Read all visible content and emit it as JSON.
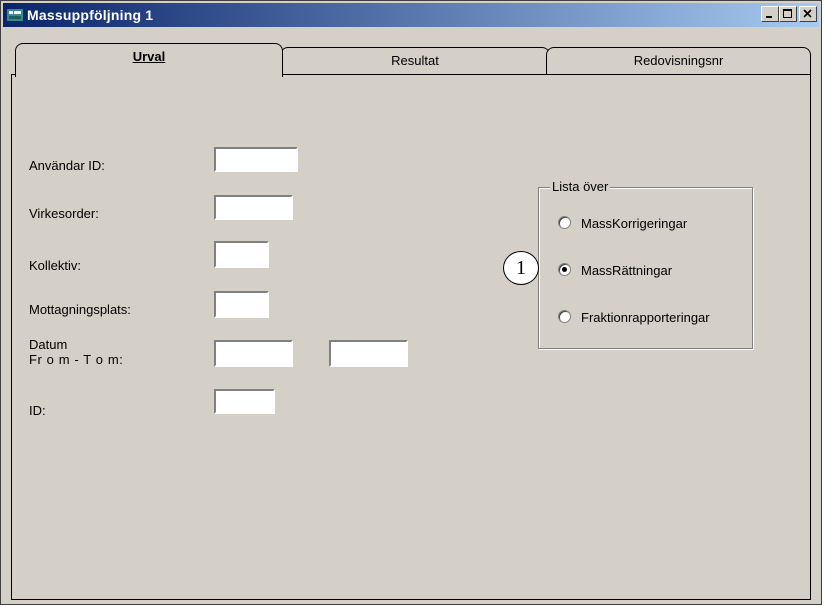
{
  "window": {
    "title": "Massuppföljning 1"
  },
  "tabs": [
    {
      "label": "Urval",
      "active": true
    },
    {
      "label": "Resultat",
      "active": false
    },
    {
      "label": "Redovisningsnr",
      "active": false
    }
  ],
  "form": {
    "user_id_label": "Användar ID:",
    "order_label": "Virkesorder:",
    "collective_label": "Kollektiv:",
    "receiving_label": "Mottagningsplats:",
    "date_label": "Datum",
    "date_sub_label": "Fr o m - T o m:",
    "id_label": "ID:",
    "user_id_value": "",
    "order_value": "",
    "collective_value": "",
    "receiving_value": "",
    "date_from_value": "",
    "date_to_value": "",
    "id_value": ""
  },
  "list_group": {
    "legend": "Lista över",
    "options": [
      {
        "label": "MassKorrigeringar",
        "selected": false
      },
      {
        "label": "MassRättningar",
        "selected": true
      },
      {
        "label": "Fraktionrapporteringar",
        "selected": false
      }
    ]
  },
  "callout": {
    "number": "1"
  },
  "colors": {
    "title_start": "#0a246a",
    "title_end": "#a6caf0",
    "face": "#d4d0c8"
  },
  "icons": [
    "app-icon",
    "minimize-icon",
    "maximize-icon",
    "close-icon"
  ]
}
